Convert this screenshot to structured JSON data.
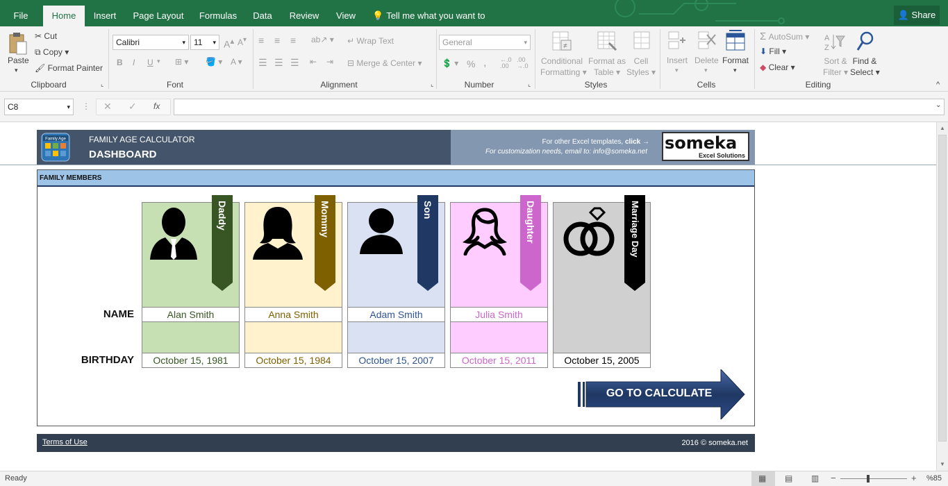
{
  "tabs": [
    "File",
    "Home",
    "Insert",
    "Page Layout",
    "Formulas",
    "Data",
    "Review",
    "View"
  ],
  "tell_me": "Tell me what you want to do",
  "share": "Share",
  "ribbon": {
    "clipboard": {
      "paste": "Paste",
      "cut": "Cut",
      "copy": "Copy",
      "format_painter": "Format Painter",
      "label": "Clipboard"
    },
    "font": {
      "family": "Calibri",
      "size": "11",
      "label": "Font",
      "bold": "B",
      "italic": "I",
      "underline": "U"
    },
    "alignment": {
      "wrap": "Wrap Text",
      "merge": "Merge & Center",
      "label": "Alignment"
    },
    "number": {
      "format": "General",
      "label": "Number",
      "percent": "%",
      "comma": ","
    },
    "styles": {
      "conditional": [
        "Conditional",
        "Formatting"
      ],
      "format_table": [
        "Format as",
        "Table"
      ],
      "cell_styles": [
        "Cell",
        "Styles"
      ],
      "label": "Styles"
    },
    "cells": {
      "insert": "Insert",
      "delete": "Delete",
      "format": "Format",
      "label": "Cells"
    },
    "editing": {
      "autosum": "AutoSum",
      "fill": "Fill",
      "clear": "Clear",
      "sort": [
        "Sort &",
        "Filter"
      ],
      "find": [
        "Find &",
        "Select"
      ],
      "label": "Editing"
    }
  },
  "formula_bar": {
    "name_box": "C8",
    "fx": "fx",
    "value": ""
  },
  "dashboard": {
    "logo_text": "Family Age",
    "title": "FAMILY AGE CALCULATOR",
    "subtitle": "DASHBOARD",
    "promo_line1": "For other Excel templates,",
    "promo_click": "click →",
    "promo_line2": "For customization needs, email to: info@someka.net",
    "brand": "someka",
    "brand_sub": "Excel Solutions",
    "section_title": "FAMILY MEMBERS",
    "name_label": "NAME",
    "birthday_label": "BIRTHDAY",
    "members": [
      {
        "role": "Daddy",
        "name": "Alan Smith",
        "birthday": "October 15, 1981",
        "bg": "#c6e0b4",
        "tag": "#375623",
        "text_color": "#375623",
        "icon": "male-silhouette-icon"
      },
      {
        "role": "Mommy",
        "name": "Anna Smith",
        "birthday": "October 15, 1984",
        "bg": "#fff2cc",
        "tag": "#7f6000",
        "text_color": "#7f6000",
        "icon": "female-silhouette-icon"
      },
      {
        "role": "Son",
        "name": "Adam Smith",
        "birthday": "October 15, 2007",
        "bg": "#d9e1f2",
        "tag": "#1f3864",
        "text_color": "#2f5496",
        "icon": "child-silhouette-icon"
      },
      {
        "role": "Daughter",
        "name": "Julia Smith",
        "birthday": "October 15, 2011",
        "bg": "#ffccff",
        "tag": "#cc66cc",
        "text_color": "#cc66cc",
        "icon": "girl-outline-icon"
      },
      {
        "role": "Marriage Day",
        "name": "",
        "birthday": "October 15, 2005",
        "bg": "#d0d0d0",
        "tag": "#000000",
        "text_color": "#000000",
        "icon": "rings-icon"
      }
    ],
    "cta": "GO TO CALCULATE",
    "footer_link": "Terms of Use",
    "footer_copy": "2016 © someka.net"
  },
  "status": {
    "ready": "Ready",
    "zoom": "%85"
  }
}
